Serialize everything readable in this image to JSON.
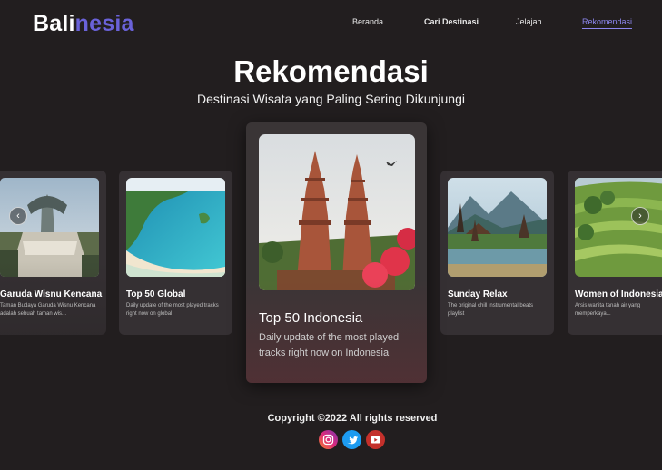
{
  "header": {
    "logo_part1": "Bali",
    "logo_part2": "nesia",
    "nav": [
      "Beranda",
      "Cari Destinasi",
      "Jelajah",
      "Rekomendasi"
    ]
  },
  "hero": {
    "title": "Rekomendasi",
    "subtitle": "Destinasi Wisata yang Paling Sering Dikunjungi"
  },
  "carousel": {
    "prev_icon": "chevron-left-icon",
    "next_icon": "chevron-right-icon",
    "cards": [
      {
        "title": "Garuda Wisnu Kencana",
        "desc": "Taman Budaya Garuda Wisnu Kencana adalah sebuah taman wis..."
      },
      {
        "title": "Top 50 Global",
        "desc": "Daily update of the most played tracks right now on global"
      },
      {
        "title": "Top 50 Indonesia",
        "desc": "Daily update of the most played tracks right now on Indonesia"
      },
      {
        "title": "Sunday Relax",
        "desc": "The original chill instrumental beats playlist"
      },
      {
        "title": "Women of Indonesia",
        "desc": "Arsis wanita tanah air yang memperkaya..."
      }
    ]
  },
  "footer": {
    "copyright": "Copyright ©2022 All rights reserved",
    "social": [
      "instagram-icon",
      "twitter-icon",
      "youtube-icon"
    ]
  },
  "colors": {
    "background": "#221e1f",
    "brand_accent": "#6a62d9",
    "instagram": "#c13584",
    "twitter": "#1d9bf0",
    "youtube": "#c4302b"
  }
}
